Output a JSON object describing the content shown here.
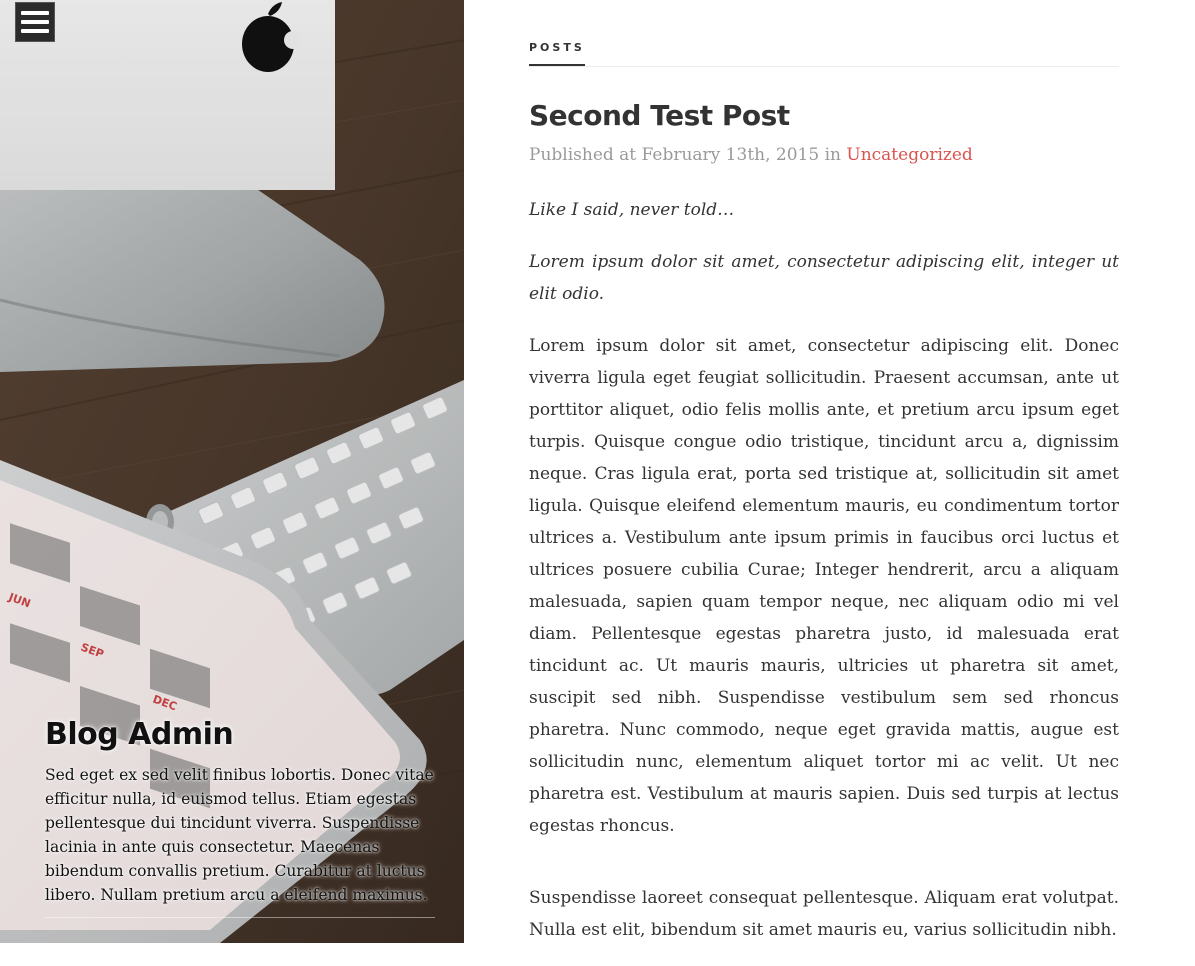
{
  "menu": {
    "icon": "hamburger-menu-icon"
  },
  "hero": {
    "title": "Blog Admin",
    "description": "Sed eget ex sed velit finibus lobortis. Donec vitae efficitur nulla, id euismod tellus. Etiam egestas pellentesque dui tincidunt viverra. Suspendisse lacinia in ante quis consectetur. Maecenas bibendum convallis pretium. Curabitur at luctus libero. Nullam pretium arcu a eleifend maximus.",
    "calendar_months": [
      "JUN",
      "SEP",
      "DEC"
    ]
  },
  "tabs": {
    "posts_label": "POSTS"
  },
  "post": {
    "title": "Second Test Post",
    "meta_prefix": "Published at February 13th, 2015 in ",
    "category": "Uncategorized",
    "paragraphs": [
      "Like I said, never told…",
      "Lorem ipsum dolor sit amet, consectetur adipiscing elit, integer ut elit odio.",
      "Lorem ipsum dolor sit amet, consectetur adipiscing elit. Donec viverra ligula eget feugiat sollicitudin. Praesent accumsan, ante ut porttitor aliquet, odio felis mollis ante, et pretium arcu ipsum eget turpis. Quisque congue odio tristique, tincidunt arcu a, dignissim neque. Cras ligula erat, porta sed tristique at, sollicitudin sit amet ligula. Quisque eleifend elementum mauris, eu condimentum tortor ultrices a. Vestibulum ante ipsum primis in faucibus orci luctus et ultrices posuere cubilia Curae; Integer hendrerit, arcu a aliquam malesuada, sapien quam tempor neque, nec aliquam odio mi vel diam. Pellentesque egestas pharetra justo, id malesuada erat tincidunt ac. Ut mauris mauris, ultricies ut pharetra sit amet, suscipit sed nibh. Suspendisse vestibulum sem sed rhoncus pharetra. Nunc commodo, neque eget gravida mattis, augue est sollicitudin nunc, elementum aliquet tortor mi ac velit. Ut nec pharetra est. Vestibulum at mauris sapien. Duis sed turpis at lectus egestas rhoncus.",
      "Suspendisse laoreet consequat pellentesque. Aliquam erat volutpat. Nulla est elit, bibendum sit amet mauris eu, varius sollicitudin nibh."
    ]
  },
  "colors": {
    "accent": "#d9534f",
    "text": "#333333",
    "meta": "#9a9a9a"
  }
}
